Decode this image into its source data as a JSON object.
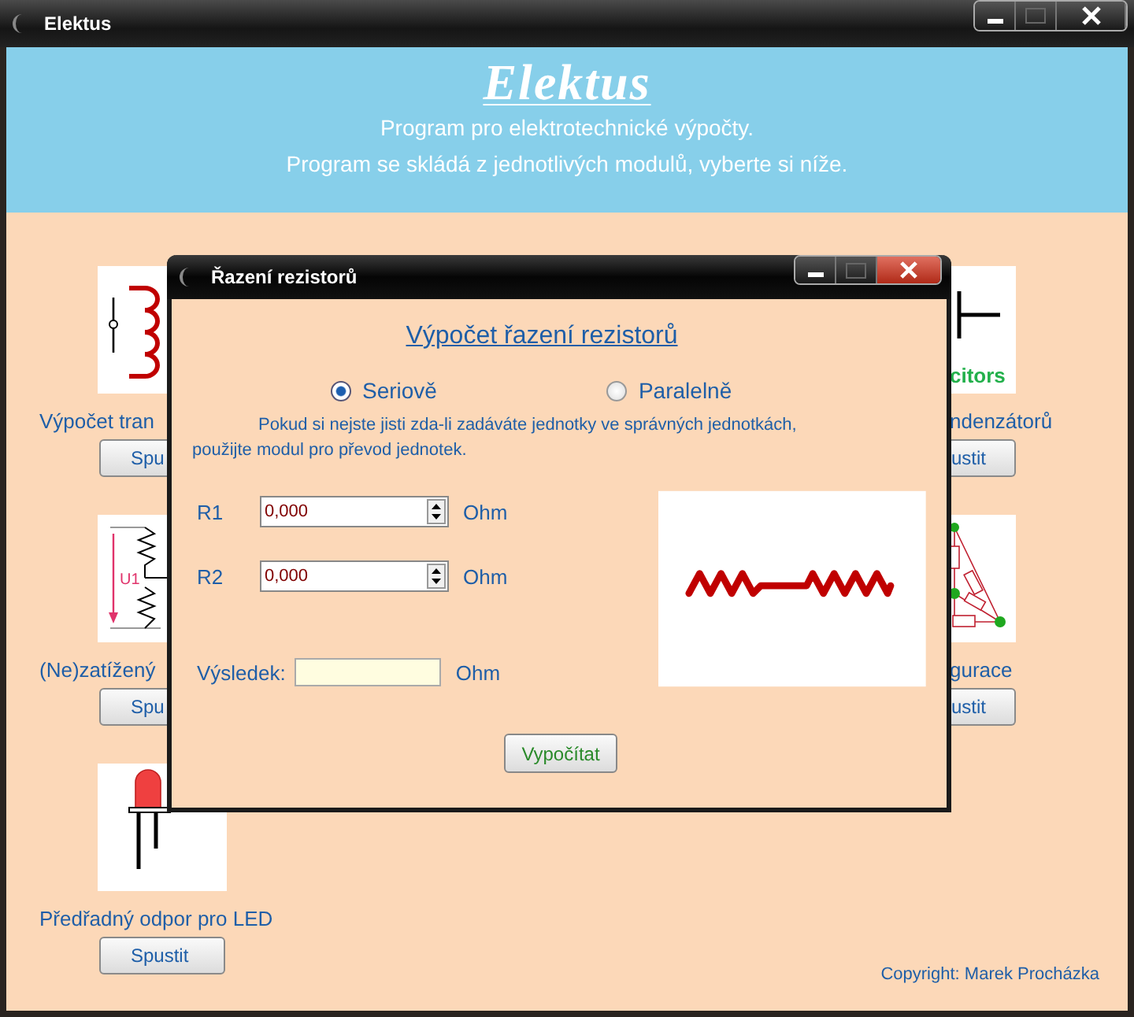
{
  "window": {
    "title": "Elektus"
  },
  "header": {
    "title": "Elektus",
    "lines": [
      "Program pro elektrotechnické výpočty.",
      "Program se skládá z jednotlivých modulů, vyberte si níže."
    ]
  },
  "left_modules": [
    {
      "kind": "coil",
      "label": "Výpočet tran",
      "button": "Spu"
    },
    {
      "kind": "divider",
      "icon_text": "U1",
      "label": "(Ne)zatížený",
      "button": "Spu"
    },
    {
      "kind": "led",
      "label": "Předřadný odpor pro LED",
      "button": "Spustit"
    }
  ],
  "right_modules": [
    {
      "kind": "capacitor",
      "icon_text": "citors",
      "label": "ndenzátorů",
      "button": "ustit"
    },
    {
      "kind": "network",
      "label": "gurace",
      "button": "ustit"
    }
  ],
  "copyright": "Copyright: Marek Procházka",
  "dialog": {
    "title": "Řazení rezistorů",
    "heading": "Výpočet řazení rezistorů",
    "modes": [
      {
        "label": "Seriově",
        "selected": true
      },
      {
        "label": "Paralelně",
        "selected": false
      }
    ],
    "note_lines": [
      "Pokud si nejste jisti zda-li zadáváte jednotky ve správných jednotkách,",
      "použijte modul pro převod jednotek."
    ],
    "inputs": [
      {
        "label": "R1",
        "value": "0,000",
        "unit": "Ohm"
      },
      {
        "label": "R2",
        "value": "0,000",
        "unit": "Ohm"
      }
    ],
    "result": {
      "label": "Výsledek:",
      "unit": "Ohm"
    },
    "button": "Vypočítat"
  }
}
